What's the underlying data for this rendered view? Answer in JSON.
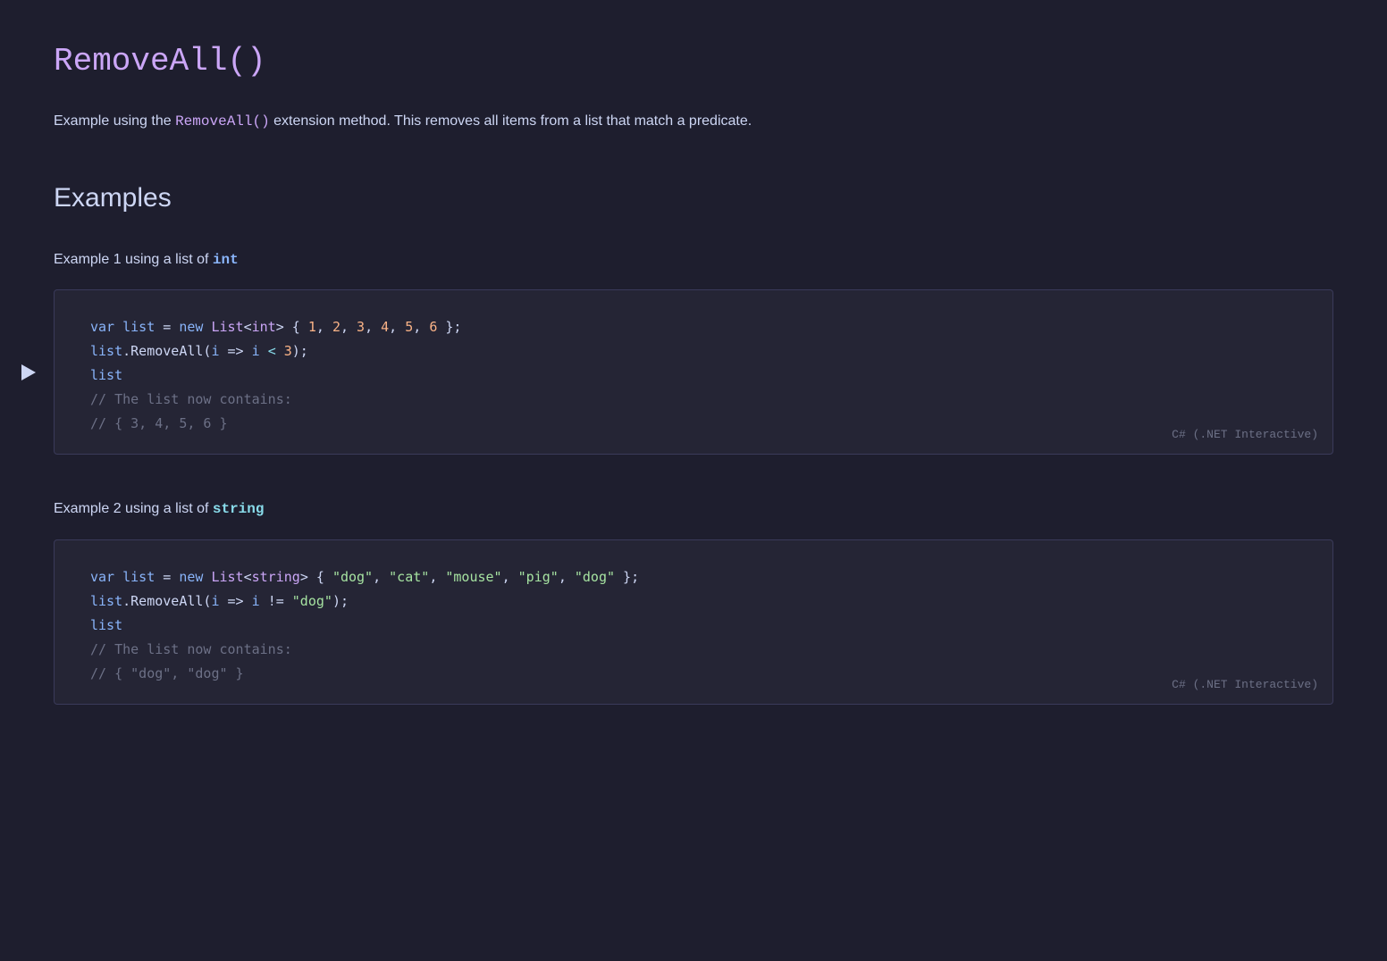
{
  "page": {
    "title": "RemoveAll()",
    "description_prefix": "Example using the ",
    "description_method": "RemoveAll()",
    "description_suffix": " extension method. This removes all items from a list that match a predicate.",
    "sections_title": "Examples",
    "examples": [
      {
        "label_prefix": "Example 1 using a list of ",
        "label_type": "int",
        "lang": "C# (.NET Interactive)",
        "code_lines": [
          "var list = new List<int> { 1, 2, 3, 4, 5, 6 };",
          "list.RemoveAll(i => i < 3);",
          "list",
          "// The list now contains:",
          "// { 3, 4, 5, 6 }"
        ]
      },
      {
        "label_prefix": "Example 2 using a list of ",
        "label_type": "string",
        "lang": "C# (.NET Interactive)",
        "code_lines": [
          "var list = new List<string> { \"dog\", \"cat\", \"mouse\", \"pig\", \"dog\" };",
          "list.RemoveAll(i => i != \"dog\");",
          "list",
          "// The list now contains:",
          "// { \"dog\", \"dog\" }"
        ]
      }
    ]
  }
}
